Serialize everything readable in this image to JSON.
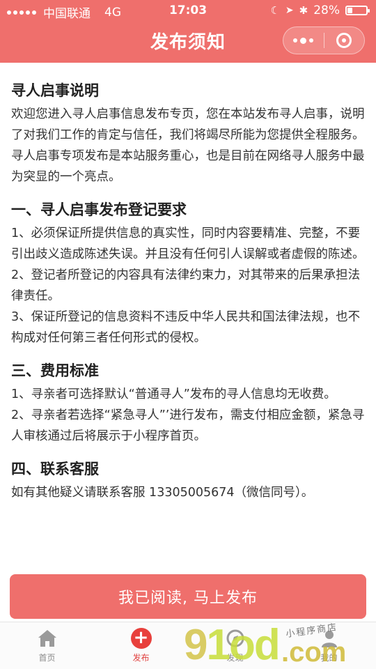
{
  "status_bar": {
    "carrier": "中国联通",
    "network": "4G",
    "time": "17:03",
    "battery": "28%",
    "battery_level": 0.28
  },
  "nav": {
    "title": "发布须知"
  },
  "sections": [
    {
      "heading": "寻人启事说明",
      "paragraphs": [
        "欢迎您进入寻人启事信息发布专页，您在本站发布寻人启事，说明了对我们工作的肯定与信任，我们将竭尽所能为您提供全程服务。寻人启事专项发布是本站服务重心，也是目前在网络寻人服务中最为突显的一个亮点。"
      ]
    },
    {
      "heading": "一、寻人启事发布登记要求",
      "paragraphs": [
        "1、必须保证所提供信息的真实性，同时内容要精准、完整，不要引出歧义造成陈述失误。并且没有任何引人误解或者虚假的陈述。",
        "2、登记者所登记的内容具有法律约束力，对其带来的后果承担法律责任。",
        "3、保证所登记的信息资料不违反中华人民共和国法律法规，也不构成对任何第三者任何形式的侵权。"
      ]
    },
    {
      "heading": "三、费用标准",
      "paragraphs": [
        "1、寻亲者可选择默认“普通寻人”发布的寻人信息均无收费。",
        "2、寻亲者若选择“紧急寻人”’进行发布，需支付相应金额，紧急寻人审核通过后将展示于小程序首页。"
      ]
    },
    {
      "heading": "四、联系客服",
      "paragraphs": [
        "如有其他疑义请联系客服 13305005674（微信同号）。"
      ]
    }
  ],
  "action": {
    "publish_label": "我已阅读, 马上发布"
  },
  "tabbar": {
    "items": [
      {
        "label": "首页",
        "icon": "home-icon",
        "active": false
      },
      {
        "label": "发布",
        "icon": "plus-icon",
        "active": true
      },
      {
        "label": "发现",
        "icon": "discover-icon",
        "active": false
      },
      {
        "label": "我的",
        "icon": "profile-icon",
        "active": false
      }
    ]
  },
  "watermark": {
    "main_g": "9",
    "main_rest": "1od",
    "tld": ".com",
    "small": "小程序商店"
  },
  "colors": {
    "brand": "#ef6f6c",
    "tab_active": "#e0413f"
  }
}
